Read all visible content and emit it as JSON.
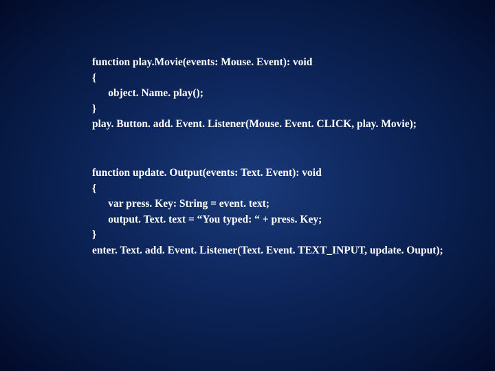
{
  "block1": {
    "l1": "function play.Movie(events: Mouse. Event): void",
    "l2": "{",
    "l3": "      object. Name. play();",
    "l4": "}",
    "l5": "play. Button. add. Event. Listener(Mouse. Event. CLICK, play. Movie);"
  },
  "block2": {
    "l1": "function update. Output(events: Text. Event): void",
    "l2": "{",
    "l3": "      var press. Key: String = event. text;",
    "l4": "      output. Text. text = “You typed: “ + press. Key;",
    "l5": "}",
    "l6": "enter. Text. add. Event. Listener(Text. Event. TEXT_INPUT, update. Ouput);"
  }
}
